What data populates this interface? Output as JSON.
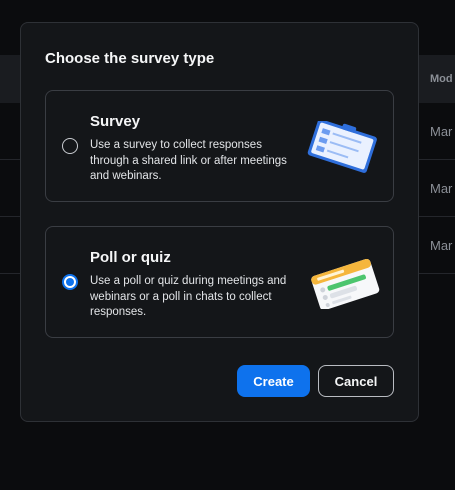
{
  "background": {
    "column_header": "Mod",
    "rows": [
      "Mar",
      "Mar",
      "Mar"
    ]
  },
  "modal": {
    "title": "Choose the survey type",
    "options": [
      {
        "title": "Survey",
        "description": "Use a survey to collect responses through a shared link or after meetings and webinars.",
        "selected": false,
        "illustration": "clipboard-illustration"
      },
      {
        "title": "Poll or quiz",
        "description": "Use a poll or quiz during meetings and webinars or a poll in chats to collect responses.",
        "selected": true,
        "illustration": "poll-card-illustration"
      }
    ],
    "buttons": {
      "create_label": "Create",
      "cancel_label": "Cancel"
    }
  },
  "colors": {
    "accent": "#0e72ed",
    "modal_bg": "#141619",
    "page_bg": "#0b0c0e"
  }
}
